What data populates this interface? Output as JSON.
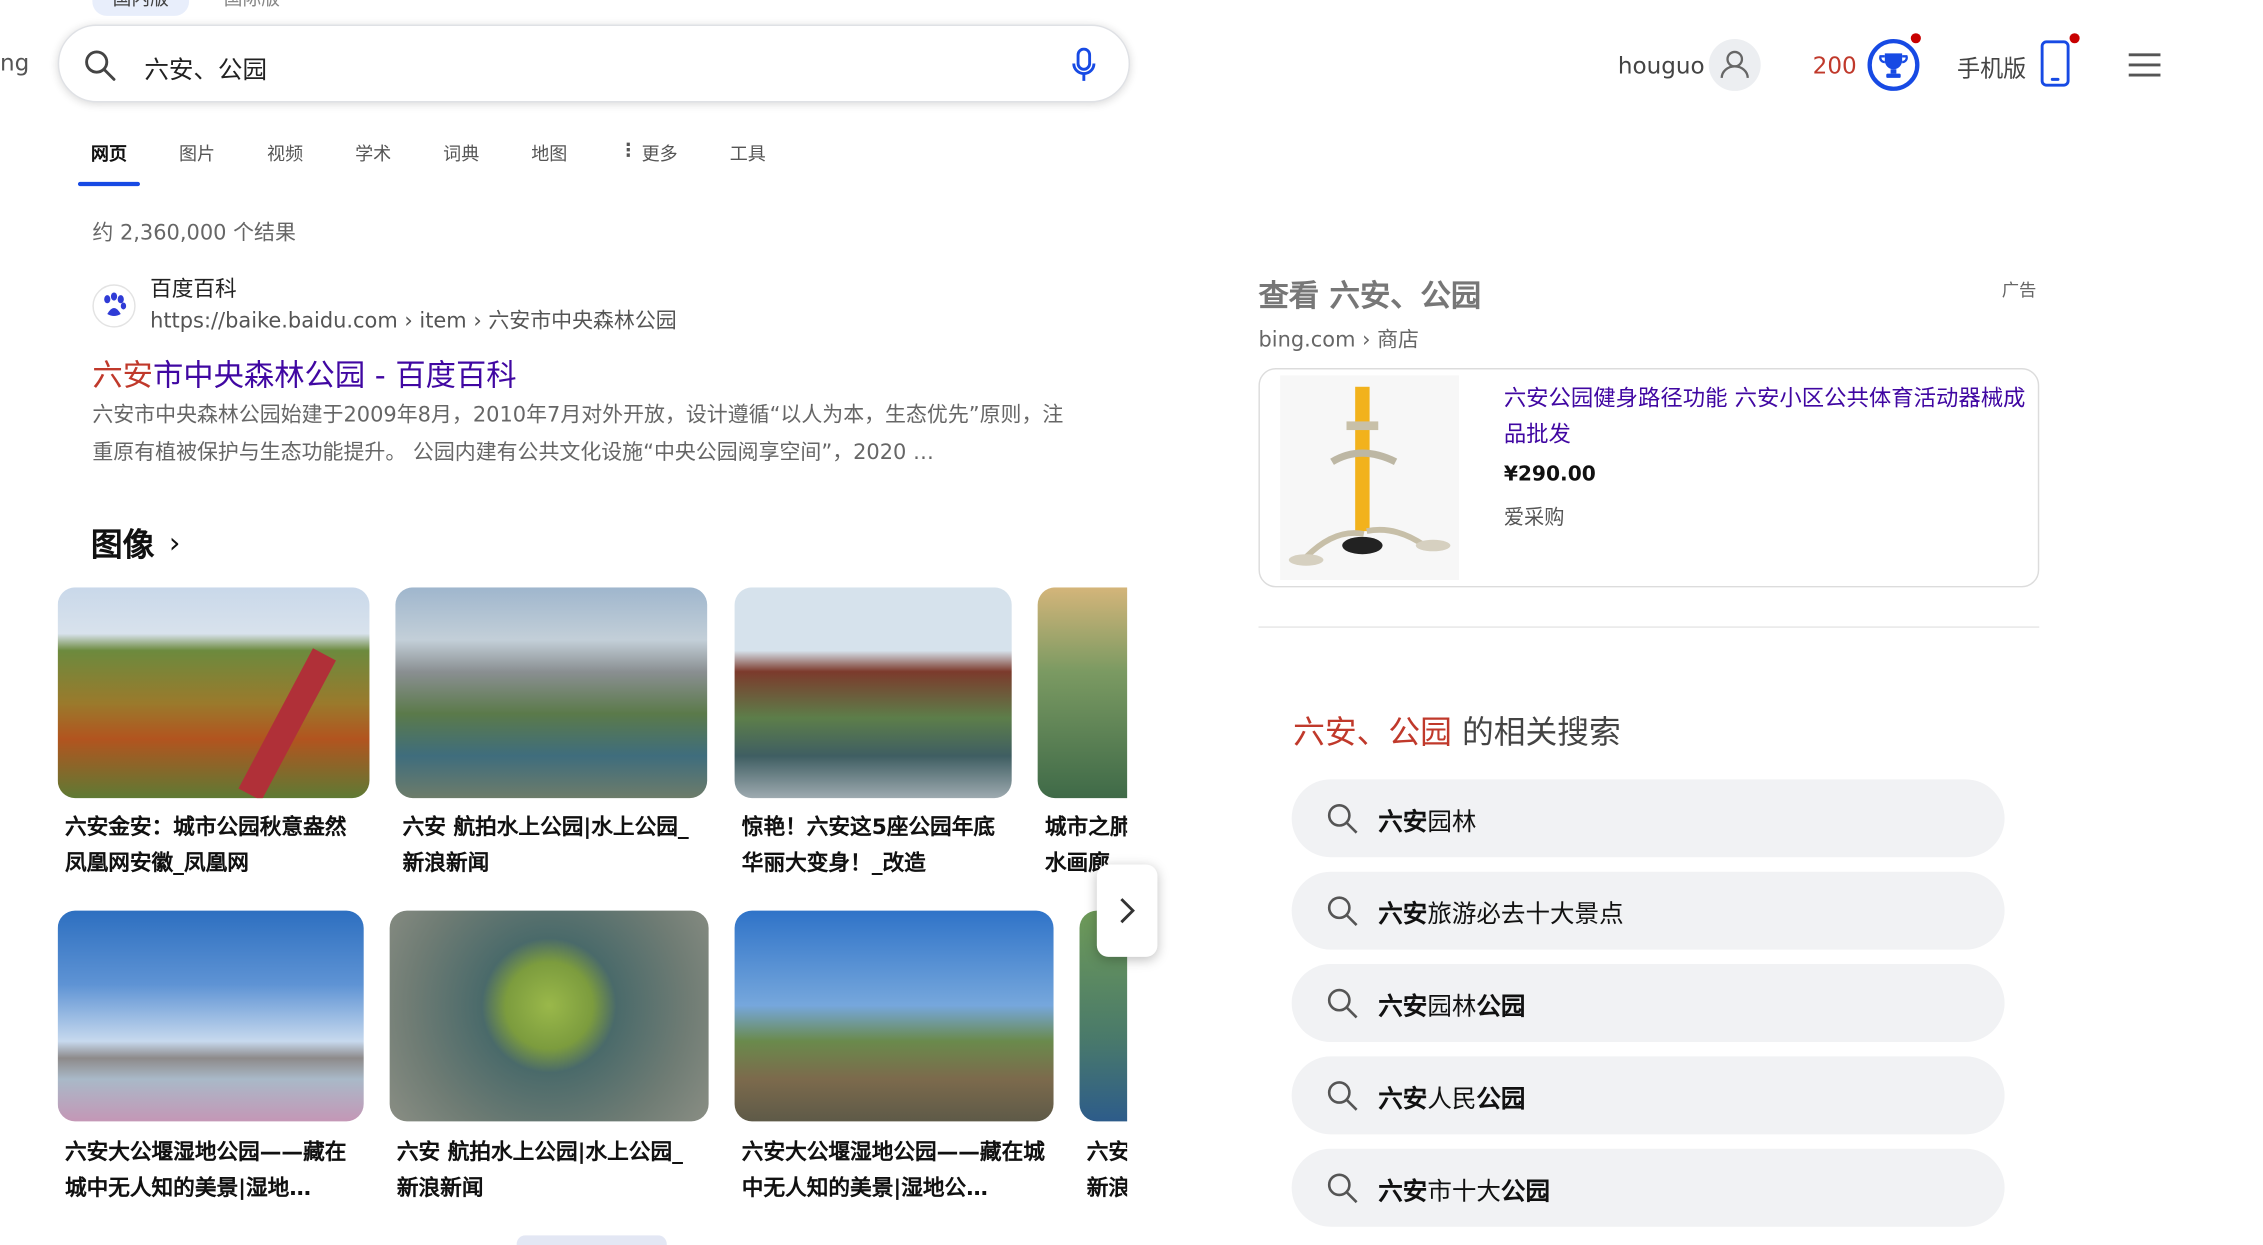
{
  "scope_tabs": [
    "国内版",
    "国际版"
  ],
  "brand_partial": "ng",
  "search": {
    "query": "六安、公园"
  },
  "nav": {
    "tabs": [
      "网页",
      "图片",
      "视频",
      "学术",
      "词典",
      "地图",
      "更多",
      "工具"
    ],
    "active": "网页"
  },
  "header": {
    "username": "houguo",
    "points": "200",
    "mobile_label": "手机版"
  },
  "results": {
    "count": "约 2,360,000 个结果",
    "first": {
      "site_name": "百度百科",
      "url": "https://baike.baidu.com › item › 六安市中央森林公园",
      "title_highlight": "六安",
      "title_rest": "市中央森林公园 - 百度百科",
      "snippet": "六安市中央森林公园始建于2009年8月，2010年7月对外开放，设计遵循“以人为本，生态优先”原则，注重原有植被保护与生态功能提升。 公园内建有公共文化设施“中央公园阅享空间”，2020 …"
    }
  },
  "images": {
    "heading": "图像",
    "items": [
      {
        "caption": "六安金安：城市公园秋意盎然凤凰网安徽_凤凰网"
      },
      {
        "caption": "六安 航拍水上公园|水上公园_新浪新闻"
      },
      {
        "caption": "惊艳！六安这5座公园年底华丽大变身！_改造"
      },
      {
        "caption": "城市之肺水画廊"
      },
      {
        "caption": "六安大公堰湿地公园——藏在城中无人知的美景|湿地…"
      },
      {
        "caption": "六安 航拍水上公园|水上公园_新浪新闻"
      },
      {
        "caption": "六安大公堰湿地公园——藏在城中无人知的美景|湿地公…"
      },
      {
        "caption": "六安新浪"
      }
    ]
  },
  "ad": {
    "title": "查看 六安、公园",
    "badge": "广告",
    "source": "bing.com › 商店",
    "product_title": "六安公园健身路径功能 六安小区公共体育活动器械成品批发",
    "price": "¥290.00",
    "seller": "爱采购"
  },
  "related": {
    "title_highlight": "六安、公园",
    "title_rest": " 的相关搜索",
    "items": [
      {
        "bold": "六安",
        "rest": "园林",
        "bold2": ""
      },
      {
        "bold": "六安",
        "rest": "旅游必去十大景点",
        "bold2": ""
      },
      {
        "bold": "六安",
        "rest": "园林",
        "bold2": "公园"
      },
      {
        "bold": "六安",
        "rest": "人民",
        "bold2": "公园"
      },
      {
        "bold": "六安",
        "rest": "市十大",
        "bold2": "公园"
      }
    ]
  },
  "colors": {
    "accent": "#174ae4",
    "link": "#4007a2",
    "highlight": "#c0392b"
  }
}
